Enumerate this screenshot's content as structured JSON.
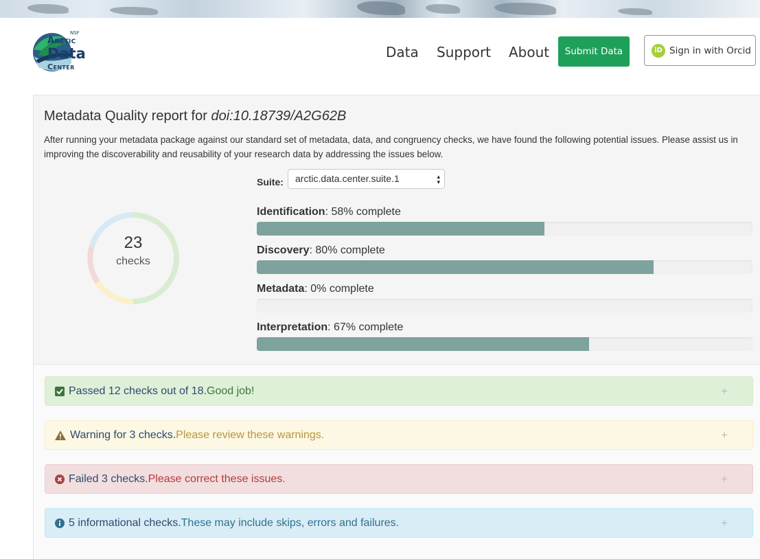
{
  "logo": {
    "nsf": "NSF",
    "arctic": "Arctic",
    "data": "Data",
    "center": "Center"
  },
  "nav": {
    "items": [
      "Data",
      "Support",
      "About"
    ],
    "submit_label": "Submit Data",
    "orcid_label": "Sign in with Orcid",
    "orcid_icon_text": "iD"
  },
  "report": {
    "title_prefix": "Metadata Quality report for ",
    "doi": "doi:10.18739/A2G62B",
    "description": "After running your metadata package against our standard set of metadata, data, and congruency checks, we have found the following potential issues. Please assist us in improving the discoverability and reusability of your research data by addressing the issues below."
  },
  "suite": {
    "label": "Suite:",
    "value": "arctic.data.center.suite.1"
  },
  "donut": {
    "count": "23",
    "label": "checks"
  },
  "categories": [
    {
      "name": "Identification",
      "text": ": 58% complete",
      "percent": 58
    },
    {
      "name": "Discovery",
      "text": ": 80% complete",
      "percent": 80
    },
    {
      "name": "Metadata",
      "text": ": 0% complete",
      "percent": 0
    },
    {
      "name": "Interpretation",
      "text": ": 67% complete",
      "percent": 67
    }
  ],
  "alerts": {
    "pass": {
      "main": "Passed 12 checks out of 18.",
      "extra": " Good job!"
    },
    "warn": {
      "main": "Warning for 3 checks.",
      "extra": " Please review these warnings."
    },
    "fail": {
      "main": "Failed 3 checks.",
      "extra": " Please correct these issues."
    },
    "info": {
      "main": "5 informational checks.",
      "extra": " These may include skips, errors and failures."
    },
    "expand_symbol": "+"
  },
  "colors": {
    "accent_green": "#1fa05a",
    "bar_fill": "#7ea29d",
    "orcid_green": "#a6ce39"
  }
}
